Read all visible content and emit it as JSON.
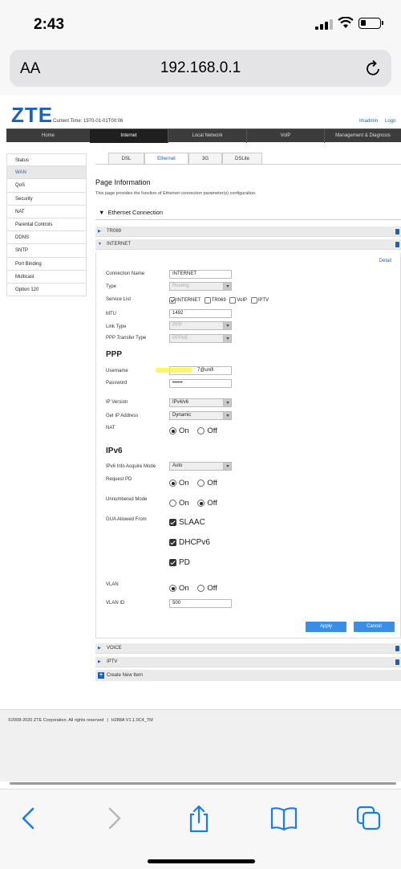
{
  "status_bar": {
    "time": "2:43"
  },
  "address_bar": {
    "aa_label": "AA",
    "url": "192.168.0.1"
  },
  "header": {
    "logo": "ZTE",
    "current_time": "Current Time: 1970-01-01T00:06",
    "user": "Imadmin",
    "logout": "Logo"
  },
  "main_nav": [
    "Home",
    "Internet",
    "Local Network",
    "VoIP",
    "Management & Diagnosis"
  ],
  "sidebar": [
    "Status",
    "WAN",
    "QoS",
    "Security",
    "NAT",
    "Parental Controls",
    "DDNS",
    "SNTP",
    "Port Binding",
    "Multicast",
    "Option 120"
  ],
  "sub_tabs": [
    "DSL",
    "Ethernet",
    "3G",
    "DSLite"
  ],
  "page_info": {
    "title": "Page Information",
    "desc": "This page provides the function of Ethernet connection parameter(s) configuration."
  },
  "section_title": "Ethernet Connection",
  "accordions": {
    "tr069": "TR069",
    "internet": "INTERNET",
    "voice": "VOICE",
    "iptv": "IPTV"
  },
  "form": {
    "detail": "Detail",
    "connection_name_label": "Connection Name",
    "connection_name_value": "INTERNET",
    "type_label": "Type",
    "type_value": "Routing",
    "service_list_label": "Service List",
    "service_internet": "INTERNET",
    "service_tr069": "TR069",
    "service_voip": "VoIP",
    "service_iptv": "IPTV",
    "mtu_label": "MTU",
    "mtu_value": "1492",
    "link_type_label": "Link Type",
    "link_type_value": "PPP",
    "ppp_transfer_label": "PPP Transfer Type",
    "ppp_transfer_value": "PPPoE",
    "ppp_heading": "PPP",
    "username_label": "Username",
    "username_value": "7@unifi",
    "password_label": "Password",
    "password_value": "••••••",
    "ip_version_label": "IP Version",
    "ip_version_value": "IPv4/v6",
    "get_ip_label": "Get IP Address",
    "get_ip_value": "Dynamic",
    "nat_label": "NAT",
    "on": "On",
    "off": "Off",
    "ipv6_heading": "IPv6",
    "ipv6_mode_label": "IPv6 Info Acquire Mode",
    "ipv6_mode_value": "Auto",
    "request_pd_label": "Request PD",
    "unnumbered_label": "Unnumbered Mode",
    "gua_label": "GUA Allowed From",
    "gua_slaac": "SLAAC",
    "gua_dhcpv6": "DHCPv6",
    "gua_pd": "PD",
    "vlan_label": "VLAN",
    "vlan_id_label": "VLAN ID",
    "vlan_id_value": "500",
    "apply": "Apply",
    "cancel": "Cancel"
  },
  "create_new": "Create New Item",
  "footer": {
    "copyright": "©2008-2020 ZTE Corporation. All rights reserved",
    "version": "H288A V1.1.0C4_TM"
  }
}
